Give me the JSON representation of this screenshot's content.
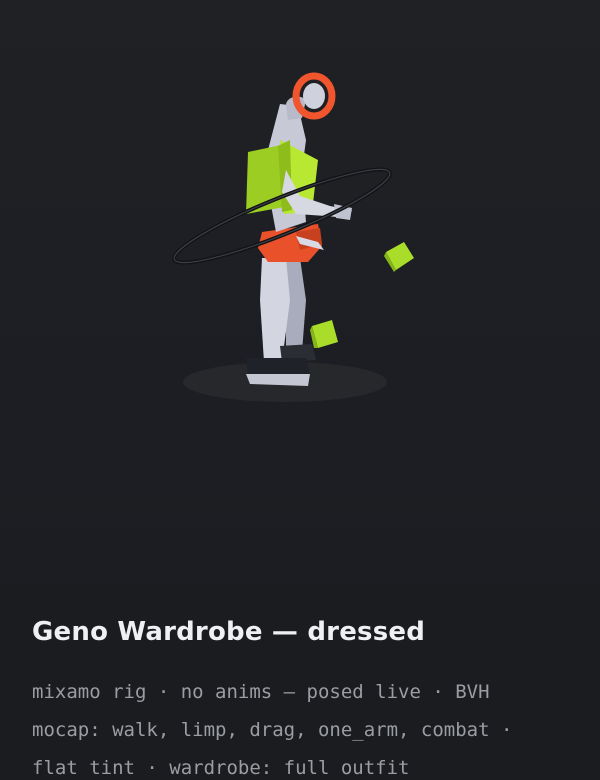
{
  "card": {
    "title": "Geno Wardrobe — dressed",
    "description_lines": [
      "mixamo rig · no anims — posed live · BVH",
      "mocap: walk, limp, drag, one_arm, combat ·",
      "flat tint · wardrobe: full outfit"
    ]
  },
  "colors": {
    "background": "#1b1d21",
    "info_panel": "#1b1c1f",
    "title_text": "#eef0f2",
    "description_text": "#9a9da3",
    "body": "#c7c9d6",
    "vest": "#a9dd2a",
    "shorts": "#e8512a",
    "halo": "#f0552e",
    "shoes": "#1f2228"
  },
  "icons": {
    "preview": "mannequin-figure-3d-render"
  }
}
